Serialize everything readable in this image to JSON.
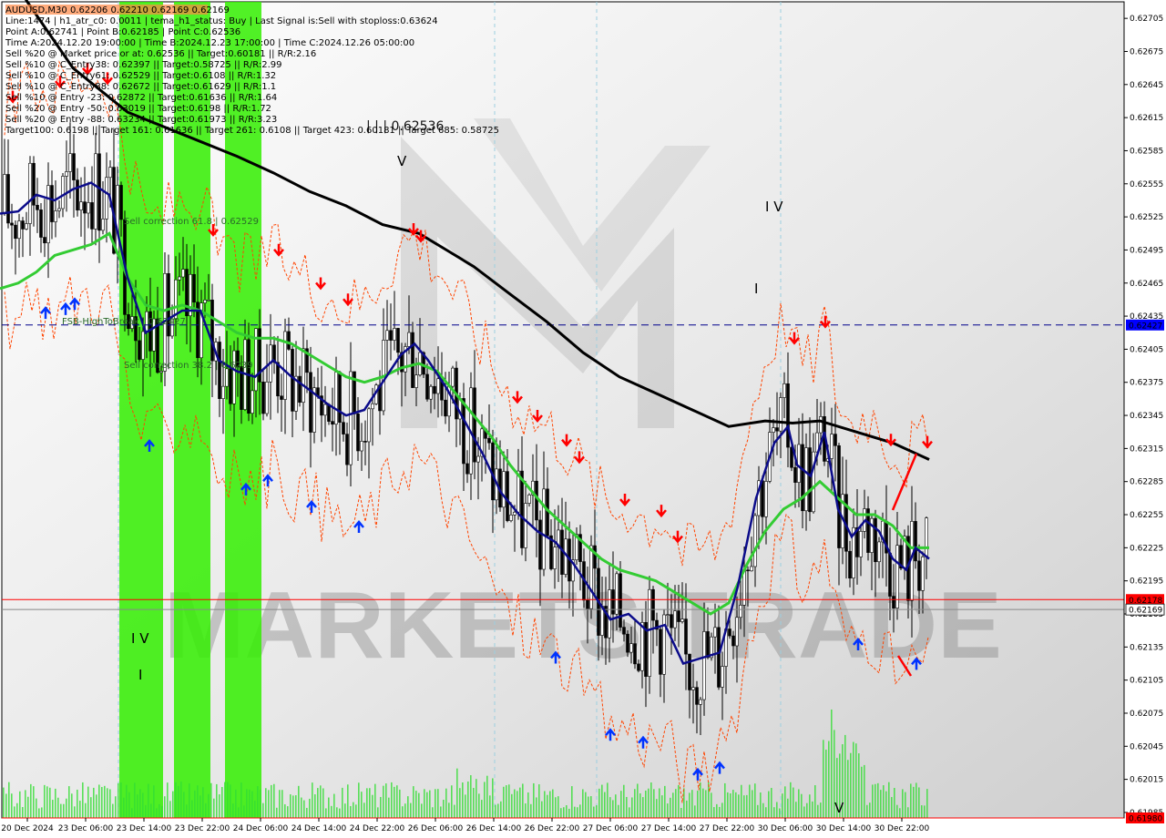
{
  "window": {
    "title": "AUDUSD,M30  0.62206 0.62210 0.62169 0.62169"
  },
  "info_panel": [
    "Line:1474 | h1_atr_c0: 0.0011 | tema_h1_status: Buy | Last Signal is:Sell with stoploss:0.63624",
    "Point A:0.62741 | Point B:0.62185 | Point C:0.62536",
    "Time A:2024.12.20 19:00:00 | Time B:2024.12.23 17:00:00 | Time C:2024.12.26 05:00:00",
    "Sell %20 @ Market price or at: 0.62536 || Target:0.60181 || R/R:2.16",
    "Sell %10 @ C_Entry38: 0.62397 || Target:0.58725 || R/R:2.99",
    "Sell %10 @ C_Entry61: 0.62529 || Target:0.6108 || R/R:1.32",
    "Sell %10 @ C_Entry88: 0.62672 || Target:0.61629 || R/R:1.1",
    "Sell %10 @ Entry -23: 0.62872 || Target:0.61636 || R/R:1.64",
    "Sell %20 @ Entry -50: 0.63019 || Target:0.6198 || R/R:1.72",
    "Sell %20 @ Entry -88: 0.63234 || Target:0.61973 || R/R:3.23",
    "Target100: 0.6198 || Target 161: 0.61636 || Target 261: 0.6108 || Target 423: 0.60181 || Target 685: 0.58725"
  ],
  "labels": {
    "point_c": "| | | 0.62536",
    "sell_corr_61": "Sell correction 61.8 | 0.62529",
    "sell_corr_38": "Sell correction 38.2 | 0.6239",
    "fsb": "FSB-HighToBreak | 0.62427",
    "wave_iv_top": "I V",
    "wave_i_mid": "I",
    "wave_v_top": "V",
    "wave_iv_bottom": "I V",
    "wave_i_bottom": "I",
    "wave_v_bottom": "V"
  },
  "watermark": "MARKETS TRADE",
  "colors": {
    "background": "#ffffff",
    "green_zone": "#33ee00",
    "ma_black": "#000000",
    "ma_navy": "#0b0b8a",
    "ma_green": "#33cc33",
    "band": "#ff4400",
    "fsb_line": "#00008b",
    "price_red": "#ff0000",
    "volume": "#33dd33",
    "buy_arrow": "#0033ff",
    "sell_arrow": "#ff0000"
  },
  "chart_data": {
    "type": "candlestick",
    "symbol": "AUDUSD",
    "timeframe": "M30",
    "ylim": [
      0.6198,
      0.6272
    ],
    "yticks": [
      0.62705,
      0.62675,
      0.62645,
      0.62615,
      0.62585,
      0.62555,
      0.62525,
      0.62495,
      0.62465,
      0.62435,
      0.62405,
      0.62375,
      0.62345,
      0.62315,
      0.62285,
      0.62255,
      0.62225,
      0.62195,
      0.62165,
      0.62135,
      0.62105,
      0.62075,
      0.62045,
      0.62015,
      0.61985
    ],
    "x_labels": [
      "20 Dec 2024",
      "23 Dec 06:00",
      "23 Dec 14:00",
      "23 Dec 22:00",
      "24 Dec 06:00",
      "24 Dec 14:00",
      "24 Dec 22:00",
      "26 Dec 06:00",
      "26 Dec 14:00",
      "26 Dec 22:00",
      "27 Dec 06:00",
      "27 Dec 14:00",
      "27 Dec 22:00",
      "30 Dec 06:00",
      "30 Dec 14:00",
      "30 Dec 22:00"
    ],
    "price_badges": [
      {
        "value": "0.62427",
        "role": "fsb",
        "color": "#0000ff"
      },
      {
        "value": "0.62178",
        "role": "level",
        "color": "#ff0000"
      },
      {
        "value": "0.62169",
        "role": "bid",
        "color": "#ffffff"
      },
      {
        "value": "0.61980",
        "role": "target",
        "color": "#ff0000"
      }
    ],
    "horizontal_levels": [
      {
        "value": 0.62427,
        "style": "dashed",
        "color": "#00008b"
      },
      {
        "value": 0.62178,
        "style": "solid",
        "color": "#ff0000"
      },
      {
        "value": 0.62169,
        "style": "solid",
        "color": "#888888"
      },
      {
        "value": 0.6198,
        "style": "solid",
        "color": "#ff0000"
      }
    ],
    "ma_black": [
      [
        0,
        0.6276
      ],
      [
        30,
        0.6272
      ],
      [
        80,
        0.6266
      ],
      [
        140,
        0.6262
      ],
      [
        200,
        0.626
      ],
      [
        260,
        0.6258
      ],
      [
        300,
        0.62565
      ],
      [
        340,
        0.62548
      ],
      [
        380,
        0.62535
      ],
      [
        420,
        0.62518
      ],
      [
        460,
        0.6251
      ],
      [
        490,
        0.62495
      ],
      [
        520,
        0.6248
      ],
      [
        560,
        0.62455
      ],
      [
        600,
        0.6243
      ],
      [
        640,
        0.62402
      ],
      [
        680,
        0.6238
      ],
      [
        720,
        0.62365
      ],
      [
        760,
        0.6235
      ],
      [
        800,
        0.62335
      ],
      [
        840,
        0.6234
      ],
      [
        870,
        0.62338
      ],
      [
        900,
        0.6234
      ],
      [
        940,
        0.6233
      ],
      [
        980,
        0.6232
      ],
      [
        1020,
        0.62305
      ]
    ],
    "ma_navy": [
      [
        0,
        0.62528
      ],
      [
        20,
        0.6253
      ],
      [
        40,
        0.62545
      ],
      [
        60,
        0.6254
      ],
      [
        80,
        0.6255
      ],
      [
        100,
        0.62556
      ],
      [
        120,
        0.62545
      ],
      [
        140,
        0.6247
      ],
      [
        160,
        0.6242
      ],
      [
        180,
        0.6243
      ],
      [
        200,
        0.6244
      ],
      [
        220,
        0.6244
      ],
      [
        240,
        0.62395
      ],
      [
        260,
        0.62385
      ],
      [
        280,
        0.6238
      ],
      [
        300,
        0.62395
      ],
      [
        320,
        0.6238
      ],
      [
        340,
        0.62368
      ],
      [
        360,
        0.62355
      ],
      [
        380,
        0.62345
      ],
      [
        400,
        0.6235
      ],
      [
        420,
        0.62375
      ],
      [
        440,
        0.624
      ],
      [
        455,
        0.6241
      ],
      [
        470,
        0.62395
      ],
      [
        490,
        0.6237
      ],
      [
        510,
        0.6234
      ],
      [
        530,
        0.6231
      ],
      [
        550,
        0.62275
      ],
      [
        570,
        0.62255
      ],
      [
        590,
        0.6224
      ],
      [
        610,
        0.6223
      ],
      [
        630,
        0.6221
      ],
      [
        650,
        0.62185
      ],
      [
        670,
        0.6216
      ],
      [
        690,
        0.62165
      ],
      [
        710,
        0.6215
      ],
      [
        730,
        0.62155
      ],
      [
        750,
        0.6212
      ],
      [
        770,
        0.62125
      ],
      [
        790,
        0.6213
      ],
      [
        810,
        0.6219
      ],
      [
        830,
        0.6227
      ],
      [
        850,
        0.6232
      ],
      [
        865,
        0.62335
      ],
      [
        875,
        0.623
      ],
      [
        890,
        0.6229
      ],
      [
        905,
        0.6233
      ],
      [
        920,
        0.6226
      ],
      [
        935,
        0.62235
      ],
      [
        950,
        0.6225
      ],
      [
        965,
        0.6224
      ],
      [
        980,
        0.62215
      ],
      [
        995,
        0.62205
      ],
      [
        1005,
        0.62225
      ],
      [
        1020,
        0.62215
      ]
    ],
    "ma_green": [
      [
        0,
        0.6246
      ],
      [
        20,
        0.62465
      ],
      [
        40,
        0.62475
      ],
      [
        60,
        0.6249
      ],
      [
        80,
        0.62495
      ],
      [
        100,
        0.625
      ],
      [
        120,
        0.6251
      ],
      [
        140,
        0.6247
      ],
      [
        160,
        0.62445
      ],
      [
        180,
        0.6244
      ],
      [
        200,
        0.62445
      ],
      [
        220,
        0.6244
      ],
      [
        240,
        0.6243
      ],
      [
        260,
        0.6242
      ],
      [
        280,
        0.62415
      ],
      [
        300,
        0.62415
      ],
      [
        320,
        0.6241
      ],
      [
        340,
        0.624
      ],
      [
        360,
        0.6239
      ],
      [
        380,
        0.6238
      ],
      [
        400,
        0.62375
      ],
      [
        420,
        0.6238
      ],
      [
        440,
        0.62388
      ],
      [
        460,
        0.62392
      ],
      [
        480,
        0.62385
      ],
      [
        500,
        0.62365
      ],
      [
        520,
        0.62345
      ],
      [
        540,
        0.62325
      ],
      [
        560,
        0.623
      ],
      [
        580,
        0.6228
      ],
      [
        600,
        0.6226
      ],
      [
        620,
        0.62245
      ],
      [
        640,
        0.6223
      ],
      [
        660,
        0.62215
      ],
      [
        680,
        0.62205
      ],
      [
        700,
        0.622
      ],
      [
        720,
        0.62195
      ],
      [
        740,
        0.62185
      ],
      [
        760,
        0.62175
      ],
      [
        780,
        0.62165
      ],
      [
        800,
        0.62175
      ],
      [
        820,
        0.6221
      ],
      [
        840,
        0.6224
      ],
      [
        860,
        0.6226
      ],
      [
        880,
        0.6227
      ],
      [
        900,
        0.62285
      ],
      [
        920,
        0.6227
      ],
      [
        940,
        0.62255
      ],
      [
        960,
        0.62255
      ],
      [
        980,
        0.62245
      ],
      [
        1000,
        0.62225
      ],
      [
        1020,
        0.62225
      ]
    ]
  }
}
